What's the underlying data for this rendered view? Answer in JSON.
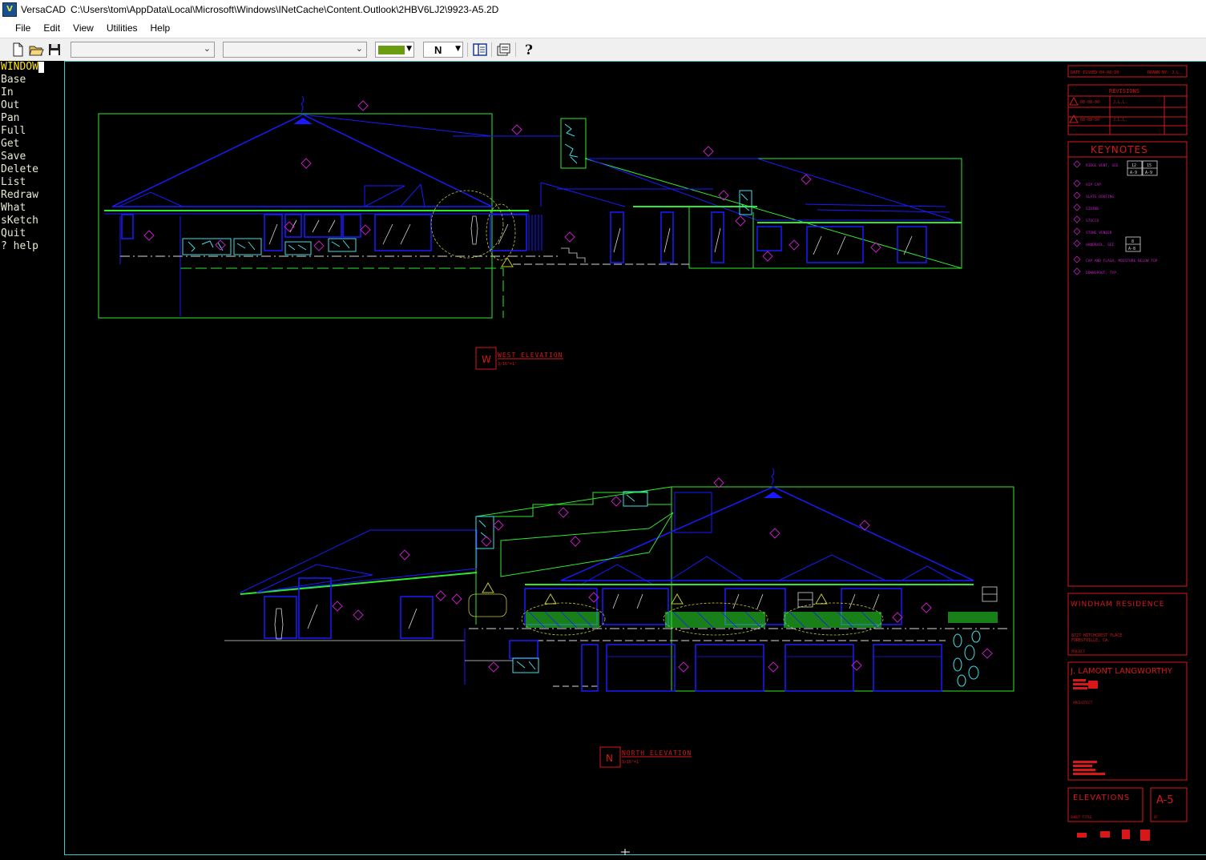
{
  "window": {
    "app_name": "VersaCAD",
    "file_path": "C:\\Users\\tom\\AppData\\Local\\Microsoft\\Windows\\INetCache\\Content.Outlook\\2HBV6LJ2\\9923-A5.2D",
    "icon": "versacad-app-icon",
    "icon_text": "V"
  },
  "menu": [
    {
      "label": "File"
    },
    {
      "label": "Edit"
    },
    {
      "label": "View"
    },
    {
      "label": "Utilities"
    },
    {
      "label": "Help"
    }
  ],
  "toolbar": {
    "layer_combo_value": "",
    "style_combo_value": "",
    "pen_value": "N",
    "color_value": "#6a9c12",
    "icons": [
      "new-file-icon",
      "open-folder-icon",
      "save-disk-icon",
      "layer-panel-icon",
      "settings-icon",
      "help-question-icon"
    ]
  },
  "command_menu": {
    "active": "WINDOW",
    "items": [
      "Base",
      "In",
      "Out",
      "Pan",
      "Full",
      "Get",
      "Save",
      "Delete",
      "List",
      "Redraw",
      "What",
      "sKetch",
      "Quit",
      "? help"
    ]
  },
  "drawing": {
    "west_label": {
      "letter": "W",
      "title": "WEST ELEVATION",
      "scale": "3/16\"=1'"
    },
    "north_label": {
      "letter": "N",
      "title": "NORTH ELEVATION",
      "scale": "3/16\"=1'"
    },
    "title_block": {
      "date_line": "DATE  ISSUED  04-08-99",
      "drawn_by": "DRAWN BY: J.L.",
      "revisions_title": "REVISIONS",
      "revisions": [
        {
          "date": "08-08-00",
          "by": "J.L.L."
        },
        {
          "date": "08-08-00",
          "by": "J.L.L."
        }
      ],
      "keynotes_title": "KEYNOTES",
      "keynotes": [
        "RIDGE VENT, SEE",
        "HIP CAP",
        "SLATE ROOFING",
        "SIDING",
        "STUCCO",
        "STONE VENEER",
        "HANDRAIL, SEE",
        "CAP AND FLASH, MOISTURE BELOW TOP",
        "DOWNSPOUT, TYP."
      ],
      "keynote_refs": [
        {
          "num": "12",
          "sheet": "A-9"
        },
        {
          "num": "15",
          "sheet": "A-9"
        },
        {
          "num": "8",
          "sheet": "A-8"
        }
      ],
      "project_name": "WINDHAM RESIDENCE",
      "project_address_1": "8727 HITCHCREST PLACE",
      "project_address_2": "FORESTVILLE, CA.",
      "project_label": "PROJECT",
      "architect_name": "J. LAMONT LANGWORTHY",
      "architect_label": "ARCHITECT",
      "sheet_title": "ELEVATIONS",
      "sheet_title_label": "SHEET TITLE",
      "sheet_number": "A-5",
      "sheet_of": "OF"
    },
    "colors": {
      "background": "#000000",
      "blue": "#1a1aff",
      "green": "#2ee82e",
      "cyan": "#3de0e8",
      "magenta": "#c020c0",
      "red": "#d81818",
      "white": "#d8d8d8",
      "frame": "#40c8c8"
    }
  }
}
